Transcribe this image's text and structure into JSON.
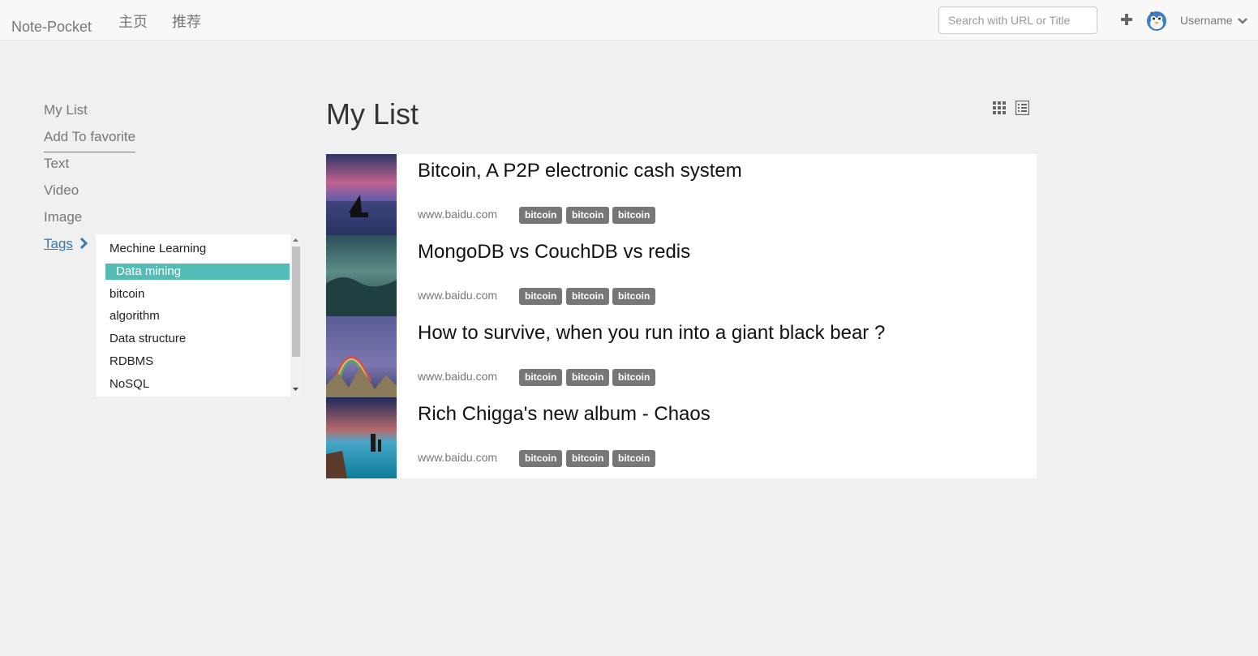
{
  "navbar": {
    "brand": "Note-Pocket",
    "links": [
      "主页",
      "推荐"
    ],
    "search_placeholder": "Search with URL or Title",
    "username": "Username"
  },
  "sidebar": {
    "items": [
      "My List",
      "Add To favorite",
      "Text",
      "Video",
      "Image",
      "Tags"
    ]
  },
  "tags": {
    "items": [
      "Mechine Learning",
      "Data mining",
      "bitcoin",
      "algorithm",
      "Data structure",
      "RDBMS",
      "NoSQL"
    ],
    "selected": "Data mining"
  },
  "main": {
    "title": "My List",
    "articles": [
      {
        "title": "Bitcoin, A P2P electronic cash system",
        "domain": "www.baidu.com",
        "tags": [
          "bitcoin",
          "bitcoin",
          "bitcoin"
        ]
      },
      {
        "title": "MongoDB vs CouchDB vs redis",
        "domain": "www.baidu.com",
        "tags": [
          "bitcoin",
          "bitcoin",
          "bitcoin"
        ]
      },
      {
        "title": "How to survive, when you run into a giant black bear ?",
        "domain": "www.baidu.com",
        "tags": [
          "bitcoin",
          "bitcoin",
          "bitcoin"
        ]
      },
      {
        "title": "Rich Chigga's new album - Chaos",
        "domain": "www.baidu.com",
        "tags": [
          "bitcoin",
          "bitcoin",
          "bitcoin"
        ]
      }
    ]
  },
  "colors": {
    "accent": "#53bdb5",
    "link": "#337ab7",
    "badge": "#777777",
    "background": "#f0f0f0"
  },
  "icons": [
    "plus-icon",
    "avatar",
    "chevron-down-icon",
    "chevron-right-icon",
    "grid-view-icon",
    "list-view-icon"
  ]
}
